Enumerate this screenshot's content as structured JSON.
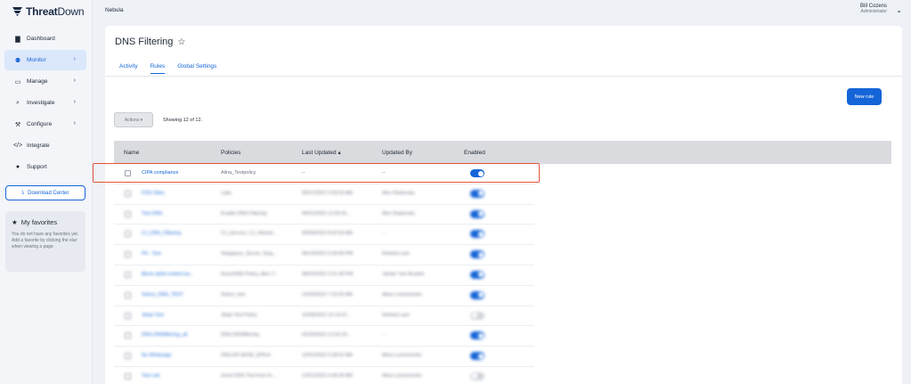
{
  "app": {
    "brand_bold": "Threat",
    "brand_light": "Down"
  },
  "sidebar": {
    "items": [
      {
        "label": "Dashboard",
        "icon": "dashboard-icon",
        "glyph": "▇",
        "chevron": false,
        "active": false
      },
      {
        "label": "Monitor",
        "icon": "binoculars-icon",
        "glyph": "⚉",
        "chevron": true,
        "active": true
      },
      {
        "label": "Manage",
        "icon": "monitor-icon",
        "glyph": "▭",
        "chevron": true,
        "active": false
      },
      {
        "label": "Investigate",
        "icon": "search-icon",
        "glyph": "⌕",
        "chevron": true,
        "active": false
      },
      {
        "label": "Configure",
        "icon": "wrench-icon",
        "glyph": "⚒",
        "chevron": true,
        "active": false
      },
      {
        "label": "Integrate",
        "icon": "code-icon",
        "glyph": "</>",
        "chevron": false,
        "active": false
      },
      {
        "label": "Support",
        "icon": "chat-icon",
        "glyph": "●",
        "chevron": false,
        "active": false
      }
    ],
    "download_center": "Download Center",
    "favorites": {
      "title": "My favorites",
      "text": "You do not have any favorites yet. Add a favorite by clicking the star when viewing a page"
    }
  },
  "topbar": {
    "tenant": "Nebula",
    "user_name": "Bill Cozens",
    "user_role": "Administrator"
  },
  "page": {
    "title": "DNS Filtering",
    "tabs": [
      {
        "label": "Activity",
        "active": false
      },
      {
        "label": "Rules",
        "active": true
      },
      {
        "label": "Global Settings",
        "active": false
      }
    ],
    "new_rule": "New rule",
    "actions": "Actions ▾",
    "showing": "Showing 12 of 12."
  },
  "table": {
    "columns": [
      "Name",
      "Policies",
      "Last Updated ▴",
      "Updated By",
      "Enabled"
    ],
    "rows": [
      {
        "name": "CIPA compliance",
        "policies": "Alina_Testpolicy",
        "updated": "--",
        "by": "--",
        "enabled": true,
        "blurred": false
      },
      {
        "name": "FOO Sites",
        "policies": "Labs",
        "updated": "05/27/2022 3:30:42 AM",
        "by": "Alen Radonsky",
        "enabled": true,
        "blurred": true
      },
      {
        "name": "Test DNS",
        "policies": "Enable DNS Filtering",
        "updated": "06/01/2022 12:00:41...",
        "by": "Alen Radonsky",
        "enabled": true,
        "blurred": true
      },
      {
        "name": "CJ_DNS_Filtering",
        "policies": "CJ_Servers, CJ_Workst...",
        "updated": "06/09/2022 8:42:05 AM",
        "by": "--",
        "enabled": true,
        "blurred": true
      },
      {
        "name": "P4 - Test",
        "policies": "Singapore_Server, Sing...",
        "updated": "06/15/2022 5:30:58 PM",
        "by": "Deleted user",
        "enabled": true,
        "blurred": true
      },
      {
        "name": "Block adult content an...",
        "policies": "AzureDNS Policy, Alen T...",
        "updated": "08/22/2022 2:21:49 PM",
        "by": "Jander Van Buskirk",
        "enabled": true,
        "blurred": true
      },
      {
        "name": "Select_DNS_TEST",
        "policies": "Select_test",
        "updated": "10/26/2022 7:20:25 AM",
        "by": "Alina Lesnichenko",
        "enabled": true,
        "blurred": true
      },
      {
        "name": "Jitopt Test",
        "policies": "Jitopt Test Policy",
        "updated": "10/28/2022 10:14:37...",
        "by": "Deleted user",
        "enabled": false,
        "blurred": true
      },
      {
        "name": "DNS-DNSfiltering_all",
        "policies": "DNS-DNSfiltering",
        "updated": "02/20/2023 12:02:24...",
        "by": "--",
        "enabled": true,
        "blurred": true
      },
      {
        "name": "No Whatsapp",
        "policies": "DNS-EP-AZSE_EP5ch",
        "updated": "12/01/2023 3:38:02 AM",
        "by": "Alina Lesnichenko",
        "enabled": true,
        "blurred": true
      },
      {
        "name": "Test rule",
        "policies": "Insert DNS Test from th...",
        "updated": "12/01/2023 3:49:36 AM",
        "by": "Alina Lesnichenko",
        "enabled": false,
        "blurred": true
      }
    ]
  },
  "colors": {
    "accent": "#1565d8",
    "highlight": "#e5533c"
  }
}
